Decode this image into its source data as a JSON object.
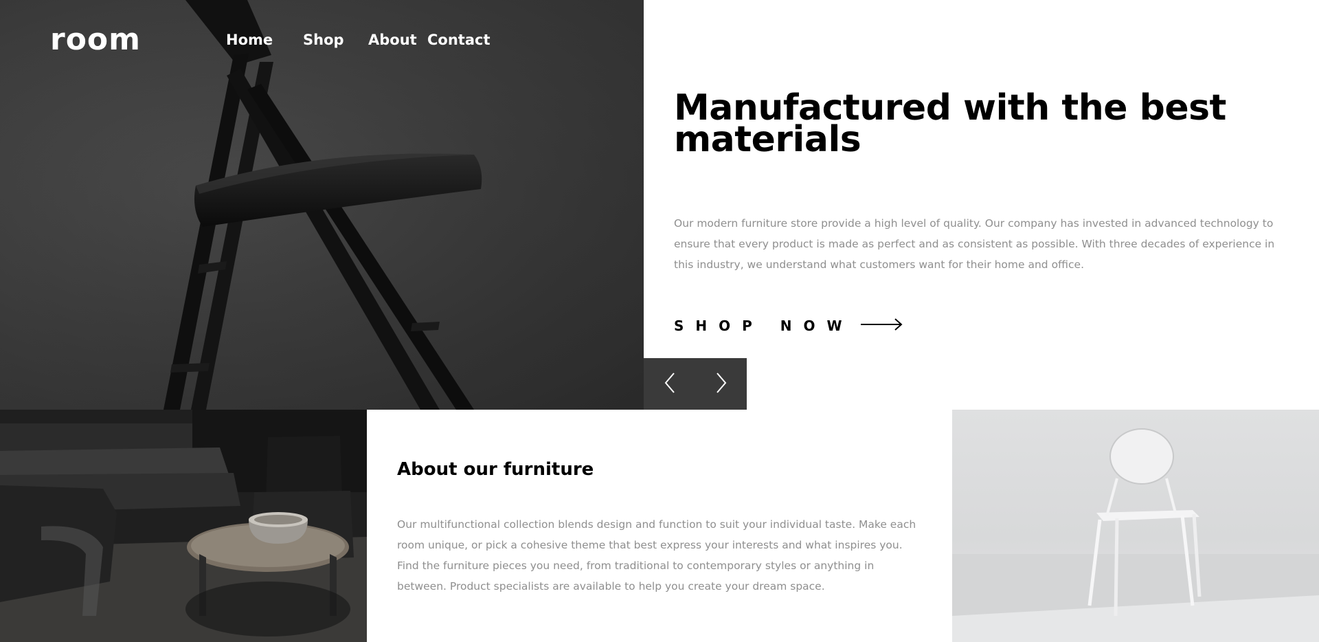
{
  "brand": {
    "logo": "room"
  },
  "nav": {
    "items": [
      {
        "label": "Home"
      },
      {
        "label": "Shop"
      },
      {
        "label": "About"
      },
      {
        "label": "Contact"
      }
    ]
  },
  "hero": {
    "title": "Manufactured with the best materials",
    "description": "Our modern furniture store provide a high level of quality. Our company has invested in advanced technology to ensure that every product is made as perfect and as consistent as possible. With three decades of experience in this industry, we understand what customers want for their home and office.",
    "cta_label": "SHOP NOW",
    "cta_icon": "arrow-right-icon",
    "image": "folding-chair-photo"
  },
  "slider": {
    "prev_icon": "chevron-left-icon",
    "next_icon": "chevron-right-icon"
  },
  "about": {
    "title": "About our furniture",
    "description": "Our multifunctional collection blends design and function to suit your individual taste. Make each room unique, or pick a cohesive theme that best express your interests and what inspires you. Find the furniture pieces you need, from traditional to contemporary styles or anything in between. Product specialists are available to help you create your dream space.",
    "image_left": "dark-living-room-photo",
    "image_right": "white-chair-photo"
  },
  "colors": {
    "text_primary": "#000000",
    "text_secondary": "#8f8f8f",
    "nav_text": "#ffffff",
    "slider_bg": "#3a3a3a"
  }
}
